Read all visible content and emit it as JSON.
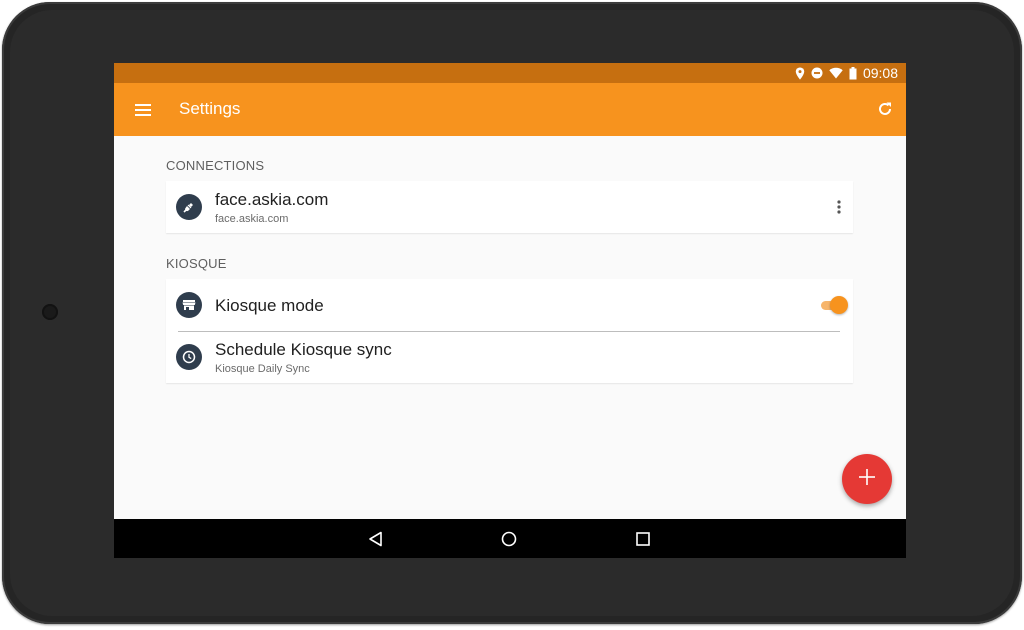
{
  "status_bar": {
    "time": "09:08",
    "icons": [
      "location-icon",
      "do-not-disturb-icon",
      "wifi-icon",
      "battery-icon"
    ]
  },
  "app_bar": {
    "menu_icon": "menu-icon",
    "title": "Settings",
    "refresh_icon": "refresh-icon"
  },
  "sections": {
    "connections": {
      "header": "CONNECTIONS",
      "items": [
        {
          "icon": "plug-icon",
          "primary": "face.askia.com",
          "secondary": "face.askia.com",
          "action_icon": "more-vert-icon"
        }
      ]
    },
    "kiosque": {
      "header": "KIOSQUE",
      "items": [
        {
          "icon": "store-icon",
          "primary": "Kiosque mode",
          "toggle_on": true
        },
        {
          "icon": "clock-icon",
          "primary": "Schedule Kiosque sync",
          "secondary": "Kiosque Daily Sync"
        }
      ]
    }
  },
  "fab": {
    "icon": "add-icon"
  },
  "nav_bar": {
    "icons": [
      "back-icon",
      "home-icon",
      "recents-icon"
    ]
  },
  "colors": {
    "status_bar": "#c66f10",
    "app_bar": "#f7931e",
    "fab": "#e53935",
    "toggle": "#f7931e",
    "list_icon_bg": "#2f3d4d"
  }
}
